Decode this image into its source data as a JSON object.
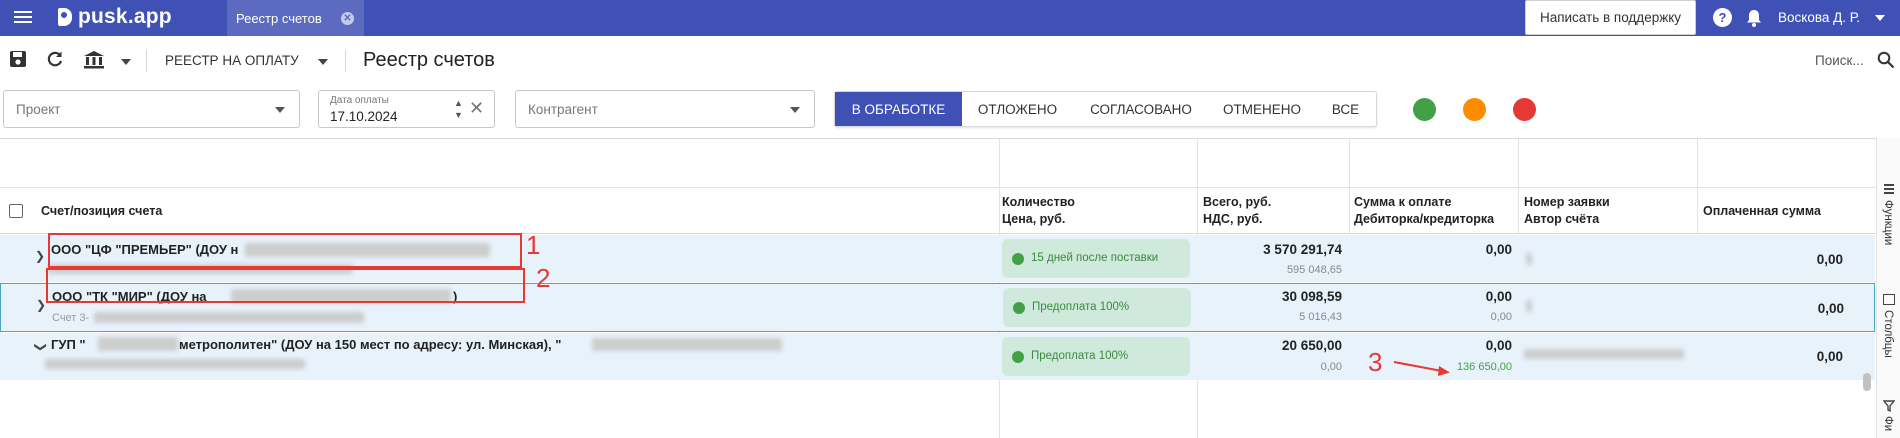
{
  "header": {
    "logo": "pusk.app",
    "tab_label": "Реестр счетов",
    "support_button": "Написать в поддержку",
    "user_name": "Воскова Д. Р."
  },
  "toolbar": {
    "mode_label": "РЕЕСТР НА ОПЛАТУ",
    "title": "Реестр счетов",
    "search_placeholder": "Поиск..."
  },
  "filters": {
    "project_placeholder": "Проект",
    "date_label": "Дата оплаты",
    "date_value": "17.10.2024",
    "counterparty_placeholder": "Контрагент",
    "status_tabs": [
      "В ОБРАБОТКЕ",
      "ОТЛОЖЕНО",
      "СОГЛАСОВАНО",
      "ОТМЕНЕНО",
      "ВСЕ"
    ],
    "active_status": "В ОБРАБОТКЕ",
    "color_dots": [
      "#43a047",
      "#fb8c00",
      "#e53935"
    ]
  },
  "table": {
    "columns": {
      "name": "Счет/позиция счета",
      "qty_line1": "Количество",
      "qty_line2": "Цена, руб.",
      "total_line1": "Всего, руб.",
      "total_line2": "НДС, руб.",
      "pay_line1": "Сумма к оплате",
      "pay_line2": "Дебиторка/кредиторка",
      "req_line1": "Номер заявки",
      "req_line2": "Автор счёта",
      "paid": "Оплаченная сумма"
    },
    "rows": [
      {
        "name": "ООО \"ЦФ \"ПРЕМЬЕР\" (ДОУ н",
        "terms": "15 дней после поставки",
        "total": "3 570 291,74",
        "vat": "595 048,65",
        "to_pay": "0,00",
        "debt": "",
        "paid": "0,00"
      },
      {
        "name": "ООО \"ТК \"МИР\" (ДОУ на",
        "name_tail": ")",
        "sub": "Счет 3-",
        "terms": "Предоплата 100%",
        "total": "30 098,59",
        "vat": "5 016,43",
        "to_pay": "0,00",
        "debt": "0,00",
        "paid": "0,00"
      },
      {
        "name": "ГУП \"",
        "name_tail": "метрополитен\" (ДОУ на 150 мест по адресу: ул. Минская), \"",
        "terms": "Предоплата 100%",
        "total": "20 650,00",
        "vat": "0,00",
        "to_pay": "0,00",
        "debt": "136 650,00",
        "paid": "0,00"
      }
    ]
  },
  "annotations": [
    "1",
    "2",
    "3"
  ],
  "side_panel": {
    "functions": "Функции",
    "columns": "Столбцы",
    "filters": "Фи"
  }
}
